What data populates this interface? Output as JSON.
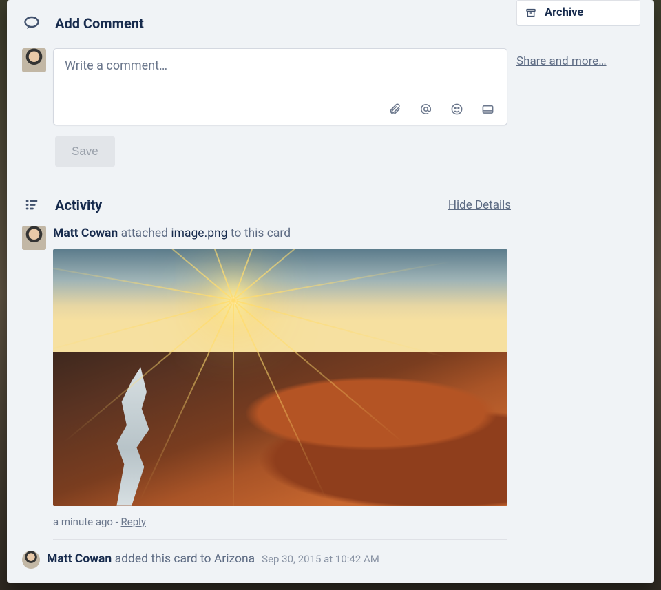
{
  "comment": {
    "title": "Add Comment",
    "placeholder": "Write a comment…",
    "save_label": "Save",
    "tool_icons": [
      "attachment-icon",
      "mention-icon",
      "emoji-icon",
      "card-icon"
    ]
  },
  "activity": {
    "title": "Activity",
    "hide_label": "Hide Details",
    "items": [
      {
        "user": "Matt Cowan",
        "action_pre": "attached",
        "file": "image.png",
        "action_post": "to this card",
        "meta_time": "a minute ago",
        "meta_sep": " - ",
        "reply": "Reply"
      },
      {
        "user": "Matt Cowan",
        "action": "added this card to Arizona",
        "timestamp": "Sep 30, 2015 at 10:42 AM"
      }
    ]
  },
  "sidebar": {
    "archive_label": "Archive",
    "share_label": "Share and more…"
  }
}
